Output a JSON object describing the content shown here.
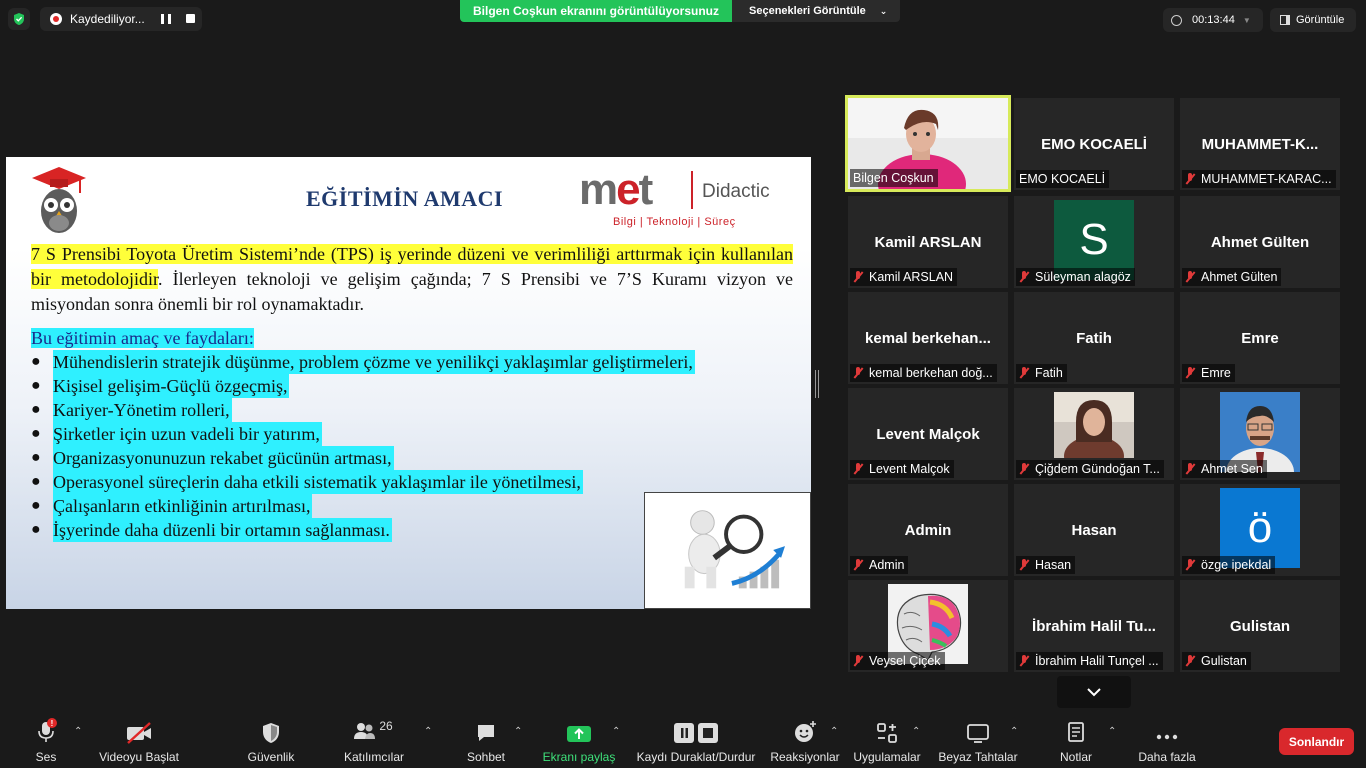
{
  "topbar": {
    "recording_label": "Kaydediliyor...",
    "share_banner": "Bilgen Coşkun ekranını görüntülüyorsunuz",
    "view_options": "Seçenekleri Görüntüle",
    "timer": "00:13:44",
    "view_label": "Görüntüle"
  },
  "slide": {
    "title": "EĞİTİMİN AMACI",
    "logo_brand_1": "m",
    "logo_brand_2": "e",
    "logo_brand_3": "t",
    "logo_name": "Didactic",
    "logo_sub": "Bilgi | Teknoloji | Süreç",
    "para_hl": "7 S Prensibi Toyota Üretim Sistemi’nde (TPS) iş yerinde  düzeni ve verimliliği arttırmak için kullanılan bir metodolojidir",
    "para_rest": ". İlerleyen teknoloji ve gelişim çağında; 7 S Prensibi ve 7’S Kuramı vizyon ve misyondan sonra önemli bir rol oynamaktadır.",
    "intro": "Bu eğitimin amaç ve faydaları:",
    "bullets": [
      "Mühendislerin stratejik düşünme, problem çözme ve yenilikçi yaklaşımlar geliştirmeleri,",
      "Kişisel gelişim-Güçlü özgeçmiş,",
      "Kariyer-Yönetim rolleri,",
      "Şirketler için uzun vadeli bir yatırım,",
      "Organizasyonunuzun rekabet gücünün artması,",
      "Operasyonel süreçlerin daha etkili sistematik yaklaşımlar ile yönetilmesi,",
      "Çalışanların etkinliğinin artırılması,",
      "İşyerinde daha düzenli bir ortamın sağlanması."
    ]
  },
  "participants": [
    {
      "big": "",
      "label": "Bilgen Coşkun",
      "muted": false,
      "kind": "video"
    },
    {
      "big": "EMO KOCAELİ",
      "label": "EMO KOCAELİ",
      "muted": false,
      "kind": "name"
    },
    {
      "big": "MUHAMMET-K...",
      "label": "MUHAMMET-KARAC...",
      "muted": true,
      "kind": "name"
    },
    {
      "big": "Kamil ARSLAN",
      "label": "Kamil ARSLAN",
      "muted": true,
      "kind": "name"
    },
    {
      "big": "S",
      "label": "Süleyman alagöz",
      "muted": true,
      "kind": "letter",
      "color": "#0d5a3e"
    },
    {
      "big": "Ahmet Gülten",
      "label": "Ahmet Gülten",
      "muted": true,
      "kind": "name"
    },
    {
      "big": "kemal  berkehan...",
      "label": "kemal berkehan doğ...",
      "muted": true,
      "kind": "name"
    },
    {
      "big": "Fatih",
      "label": "Fatih",
      "muted": true,
      "kind": "name"
    },
    {
      "big": "Emre",
      "label": "Emre",
      "muted": true,
      "kind": "name"
    },
    {
      "big": "Levent Malçok",
      "label": "Levent Malçok",
      "muted": true,
      "kind": "name"
    },
    {
      "big": "",
      "label": "Çiğdem Gündoğan T...",
      "muted": true,
      "kind": "photo-woman"
    },
    {
      "big": "",
      "label": "Ahmet Sen",
      "muted": true,
      "kind": "photo-man"
    },
    {
      "big": "Admin",
      "label": "Admin",
      "muted": true,
      "kind": "name"
    },
    {
      "big": "Hasan",
      "label": "Hasan",
      "muted": true,
      "kind": "name"
    },
    {
      "big": "ö",
      "label": "özge ipekdal",
      "muted": true,
      "kind": "letter",
      "color": "#0a78d2"
    },
    {
      "big": "",
      "label": "Veysel Çiçek",
      "muted": true,
      "kind": "photo-brain"
    },
    {
      "big": "İbrahim  Halil Tu...",
      "label": "İbrahim Halil Tunçel ...",
      "muted": true,
      "kind": "name"
    },
    {
      "big": "Gulistan",
      "label": "Gulistan",
      "muted": true,
      "kind": "name"
    }
  ],
  "toolbar": {
    "audio": "Ses",
    "video": "Videoyu Başlat",
    "security": "Güvenlik",
    "participants": "Katılımcılar",
    "participants_count": "26",
    "chat": "Sohbet",
    "share": "Ekranı paylaş",
    "record": "Kaydı Duraklat/Durdur",
    "reactions": "Reaksiyonlar",
    "apps": "Uygulamalar",
    "whiteboard": "Beyaz Tahtalar",
    "notes": "Notlar",
    "more": "Daha fazla",
    "end": "Sonlandır"
  },
  "colors": {
    "share_banner": "#23c45a",
    "end_button": "#d9282c",
    "active_speaker_border": "#d7ea5a",
    "highlight_yellow": "#ffff3a",
    "highlight_cyan": "#2ff0ff"
  }
}
